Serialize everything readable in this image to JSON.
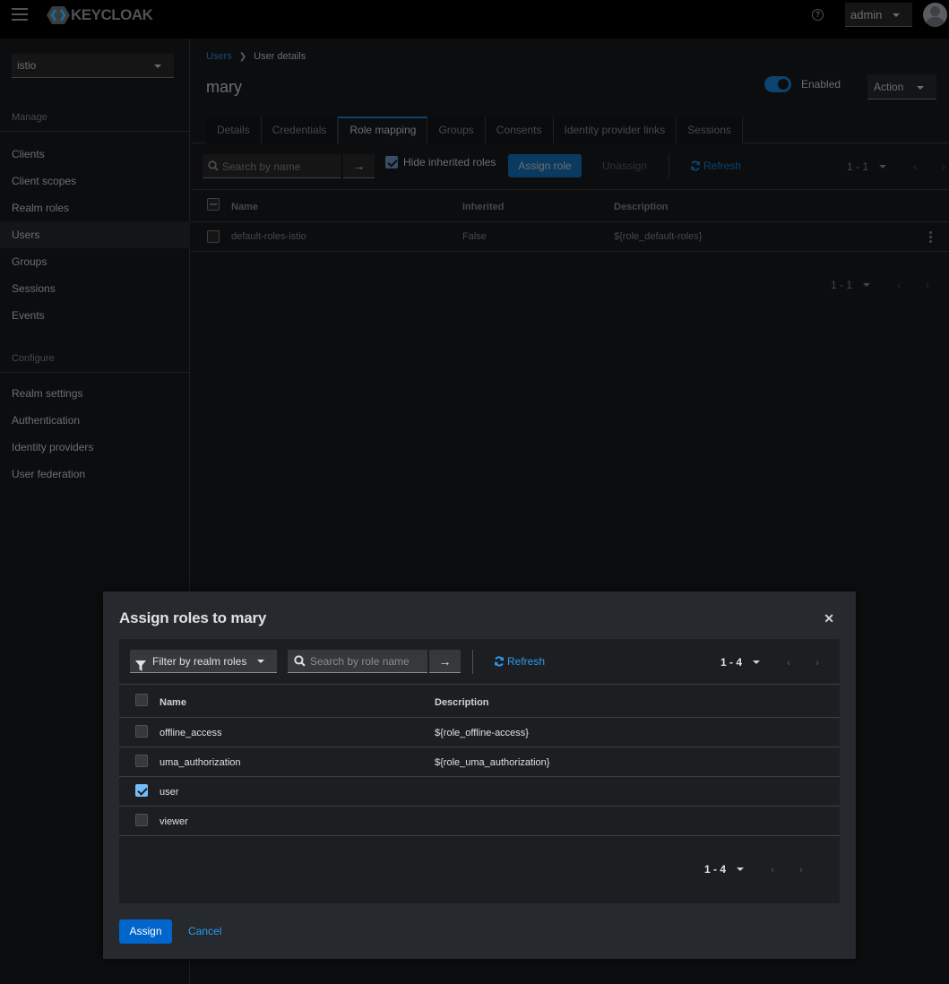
{
  "masthead": {
    "brand": "KEYCLOAK",
    "help_icon": "question-circle-icon",
    "user_menu": "admin",
    "avatar_icon": "user-avatar-icon"
  },
  "sidebar": {
    "realm": "istio",
    "sections": [
      {
        "title": "Manage",
        "items": [
          {
            "label": "Clients",
            "active": false
          },
          {
            "label": "Client scopes",
            "active": false
          },
          {
            "label": "Realm roles",
            "active": false
          },
          {
            "label": "Users",
            "active": true
          },
          {
            "label": "Groups",
            "active": false
          },
          {
            "label": "Sessions",
            "active": false
          },
          {
            "label": "Events",
            "active": false
          }
        ]
      },
      {
        "title": "Configure",
        "items": [
          {
            "label": "Realm settings",
            "active": false
          },
          {
            "label": "Authentication",
            "active": false
          },
          {
            "label": "Identity providers",
            "active": false
          },
          {
            "label": "User federation",
            "active": false
          }
        ]
      }
    ]
  },
  "page": {
    "breadcrumb": {
      "parent": "Users",
      "current": "User details"
    },
    "title": "mary",
    "enabled_label": "Enabled",
    "enabled": true,
    "action_label": "Action",
    "tabs": [
      "Details",
      "Credentials",
      "Role mapping",
      "Groups",
      "Consents",
      "Identity provider links",
      "Sessions"
    ],
    "active_tab": "Role mapping",
    "toolbar": {
      "search_placeholder": "Search by name",
      "hide_inherited_label": "Hide inherited roles",
      "hide_inherited_checked": true,
      "assign_role_label": "Assign role",
      "unassign_label": "Unassign",
      "refresh_label": "Refresh",
      "pagination": "1 - 1"
    },
    "table": {
      "columns": [
        "Name",
        "Inherited",
        "Description"
      ],
      "rows": [
        {
          "name": "default-roles-istio",
          "inherited": "False",
          "description": "${role_default-roles}"
        }
      ]
    },
    "bottom_pagination": "1 - 1"
  },
  "modal": {
    "title": "Assign roles to mary",
    "filter_label": "Filter by realm roles",
    "search_placeholder": "Search by role name",
    "refresh_label": "Refresh",
    "pagination": "1 - 4",
    "columns": [
      "Name",
      "Description"
    ],
    "rows": [
      {
        "name": "offline_access",
        "description": "${role_offline-access}",
        "checked": false
      },
      {
        "name": "uma_authorization",
        "description": "${role_uma_authorization}",
        "checked": false
      },
      {
        "name": "user",
        "description": "",
        "checked": true
      },
      {
        "name": "viewer",
        "description": "",
        "checked": false
      }
    ],
    "bottom_pagination": "1 - 4",
    "assign_label": "Assign",
    "cancel_label": "Cancel"
  }
}
